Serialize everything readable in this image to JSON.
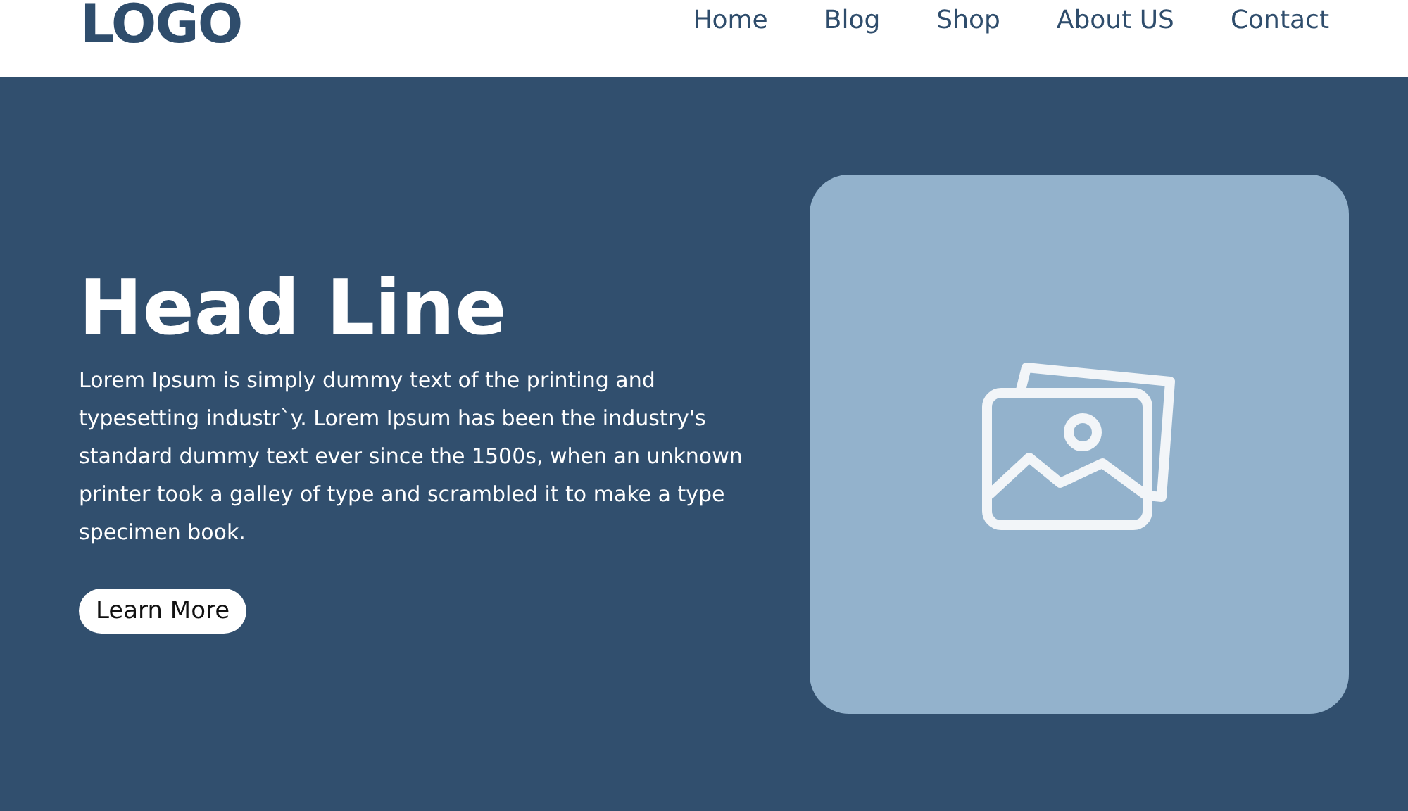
{
  "header": {
    "logo": "LOGO",
    "nav": [
      {
        "label": "Home"
      },
      {
        "label": "Blog"
      },
      {
        "label": "Shop"
      },
      {
        "label": "About US"
      },
      {
        "label": "Contact"
      }
    ]
  },
  "hero": {
    "headline": "Head Line",
    "text": "Lorem Ipsum is simply dummy text of the printing and typesetting industr`y. Lorem Ipsum has been the industry's standard dummy text ever since the 1500s, when an unknown printer took a galley of type and scrambled it to make a type specimen book.",
    "button": "Learn More"
  }
}
